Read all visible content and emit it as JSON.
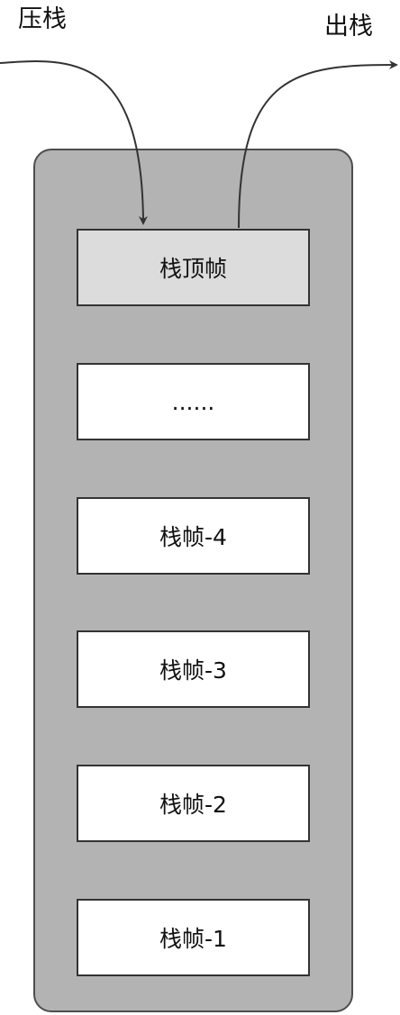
{
  "labels": {
    "push": "压栈",
    "pop": "出栈"
  },
  "stack": {
    "frames": [
      {
        "label": "栈顶帧",
        "highlight": true
      },
      {
        "label": "......",
        "highlight": false
      },
      {
        "label": "栈帧-4",
        "highlight": false
      },
      {
        "label": "栈帧-3",
        "highlight": false
      },
      {
        "label": "栈帧-2",
        "highlight": false
      },
      {
        "label": "栈帧-1",
        "highlight": false
      }
    ]
  },
  "colors": {
    "stack_fill": "#b3b3b3",
    "stack_border": "#4d4d4d",
    "top_frame_fill": "#dcdcdc",
    "frame_fill": "#ffffff",
    "arrow": "#333333"
  }
}
